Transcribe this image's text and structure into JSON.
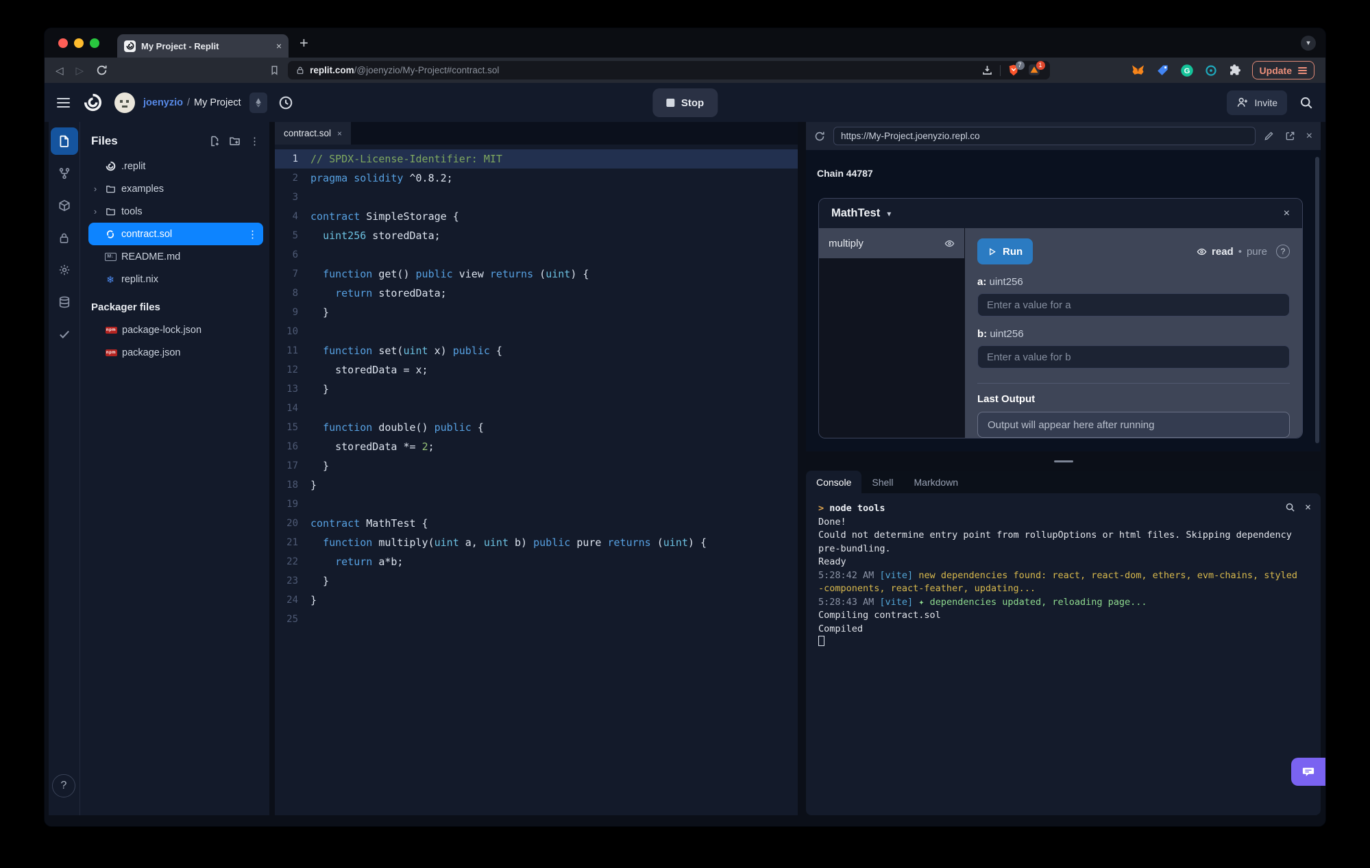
{
  "browser": {
    "tab_title": "My Project - Replit",
    "new_tab": "+",
    "tab_close": "×",
    "tab_search_caret": "▾",
    "back": "◁",
    "forward": "▷",
    "url_host": "replit.com",
    "url_path": "/@joenyzio/My-Project#contract.sol",
    "shield_badge": "7",
    "adshield_badge": "1",
    "update_label": "Update"
  },
  "header": {
    "username": "joenyzio",
    "separator": "/",
    "project": "My Project",
    "stop_label": "Stop",
    "invite_label": "Invite"
  },
  "files": {
    "title": "Files",
    "kebab": "⋮",
    "chevron": "›",
    "items": [
      {
        "label": ".replit",
        "icon": "replit-swirl",
        "chevron": false,
        "selected": false
      },
      {
        "label": "examples",
        "icon": "folder",
        "chevron": true,
        "selected": false
      },
      {
        "label": "tools",
        "icon": "folder",
        "chevron": true,
        "selected": false
      },
      {
        "label": "contract.sol",
        "icon": "solidity",
        "chevron": false,
        "selected": true
      },
      {
        "label": "README.md",
        "icon": "markdown",
        "chevron": false,
        "selected": false
      },
      {
        "label": "replit.nix",
        "icon": "nix",
        "chevron": false,
        "selected": false
      }
    ],
    "packager_heading": "Packager files",
    "packager_items": [
      {
        "label": "package-lock.json",
        "icon": "npm"
      },
      {
        "label": "package.json",
        "icon": "npm"
      }
    ],
    "help": "?"
  },
  "editor": {
    "tab": "contract.sol",
    "tab_close": "×",
    "active_line": 1,
    "lines": [
      {
        "t": [
          [
            "cm",
            "// SPDX-License-Identifier: MIT"
          ]
        ]
      },
      {
        "t": [
          [
            "kw",
            "pragma"
          ],
          [
            "pl",
            " "
          ],
          [
            "kw",
            "solidity"
          ],
          [
            "pl",
            " ^0.8.2;"
          ]
        ]
      },
      {
        "t": []
      },
      {
        "t": [
          [
            "kw",
            "contract"
          ],
          [
            "pl",
            " SimpleStorage {"
          ]
        ]
      },
      {
        "t": [
          [
            "pl",
            "  "
          ],
          [
            "ty",
            "uint256"
          ],
          [
            "pl",
            " storedData;"
          ]
        ]
      },
      {
        "t": []
      },
      {
        "t": [
          [
            "pl",
            "  "
          ],
          [
            "kw",
            "function"
          ],
          [
            "pl",
            " get() "
          ],
          [
            "kw",
            "public"
          ],
          [
            "pl",
            " view "
          ],
          [
            "kw",
            "returns"
          ],
          [
            "pl",
            " ("
          ],
          [
            "ty",
            "uint"
          ],
          [
            "pl",
            ") {"
          ]
        ]
      },
      {
        "t": [
          [
            "pl",
            "    "
          ],
          [
            "kw",
            "return"
          ],
          [
            "pl",
            " storedData;"
          ]
        ]
      },
      {
        "t": [
          [
            "pl",
            "  }"
          ]
        ]
      },
      {
        "t": []
      },
      {
        "t": [
          [
            "pl",
            "  "
          ],
          [
            "kw",
            "function"
          ],
          [
            "pl",
            " set("
          ],
          [
            "ty",
            "uint"
          ],
          [
            "pl",
            " x) "
          ],
          [
            "kw",
            "public"
          ],
          [
            "pl",
            " {"
          ]
        ]
      },
      {
        "t": [
          [
            "pl",
            "    storedData = x;"
          ]
        ]
      },
      {
        "t": [
          [
            "pl",
            "  }"
          ]
        ]
      },
      {
        "t": []
      },
      {
        "t": [
          [
            "pl",
            "  "
          ],
          [
            "kw",
            "function"
          ],
          [
            "pl",
            " double() "
          ],
          [
            "kw",
            "public"
          ],
          [
            "pl",
            " {"
          ]
        ]
      },
      {
        "t": [
          [
            "pl",
            "    storedData *= "
          ],
          [
            "nu",
            "2"
          ],
          [
            "pl",
            ";"
          ]
        ]
      },
      {
        "t": [
          [
            "pl",
            "  }"
          ]
        ]
      },
      {
        "t": [
          [
            "pl",
            "}"
          ]
        ]
      },
      {
        "t": []
      },
      {
        "t": [
          [
            "kw",
            "contract"
          ],
          [
            "pl",
            " MathTest {"
          ]
        ]
      },
      {
        "t": [
          [
            "pl",
            "  "
          ],
          [
            "kw",
            "function"
          ],
          [
            "pl",
            " multiply("
          ],
          [
            "ty",
            "uint"
          ],
          [
            "pl",
            " a, "
          ],
          [
            "ty",
            "uint"
          ],
          [
            "pl",
            " b) "
          ],
          [
            "kw",
            "public"
          ],
          [
            "pl",
            " pure "
          ],
          [
            "kw",
            "returns"
          ],
          [
            "pl",
            " ("
          ],
          [
            "ty",
            "uint"
          ],
          [
            "pl",
            ") {"
          ]
        ]
      },
      {
        "t": [
          [
            "pl",
            "    "
          ],
          [
            "kw",
            "return"
          ],
          [
            "pl",
            " a*b;"
          ]
        ]
      },
      {
        "t": [
          [
            "pl",
            "  }"
          ]
        ]
      },
      {
        "t": [
          [
            "pl",
            "}"
          ]
        ]
      },
      {
        "t": []
      }
    ]
  },
  "webview": {
    "url": "https://My-Project.joenyzio.repl.co",
    "chain": "Chain 44787",
    "contract_name": "MathTest",
    "caret": "▾",
    "close": "×",
    "method": "multiply",
    "run_label": "Run",
    "badge_read": "read",
    "badge_dot": "•",
    "badge_pure": "pure",
    "badge_help": "?",
    "a_label": "a:",
    "a_type": " uint256",
    "a_placeholder": "Enter a value for a",
    "b_label": "b:",
    "b_type": " uint256",
    "b_placeholder": "Enter a value for b",
    "last_output_label": "Last Output",
    "output_placeholder": "Output will appear here after running"
  },
  "console": {
    "tabs": [
      "Console",
      "Shell",
      "Markdown"
    ],
    "close": "×",
    "lines": [
      [
        [
          "prom",
          "> "
        ],
        [
          "bold",
          "node tools"
        ]
      ],
      [
        [
          "p",
          "Done!"
        ]
      ],
      [
        [
          "p",
          "Could not determine entry point from rollupOptions or html files. Skipping dependency"
        ]
      ],
      [
        [
          "p",
          "pre-bundling."
        ]
      ],
      [
        [
          "p",
          "Ready"
        ]
      ],
      [
        [
          "dim",
          "5:28:42 AM "
        ],
        [
          "vite",
          "[vite]"
        ],
        [
          "warn",
          " new dependencies found: react, react-dom, ethers, evm-chains, styled"
        ]
      ],
      [
        [
          "warn",
          "-components, react-feather, updating..."
        ]
      ],
      [
        [
          "dim",
          "5:28:43 AM "
        ],
        [
          "vite",
          "[vite]"
        ],
        [
          "ok",
          " ✦ dependencies updated, reloading page..."
        ]
      ],
      [
        [
          "p",
          "Compiling contract.sol"
        ]
      ],
      [
        [
          "p",
          "Compiled"
        ]
      ],
      [
        [
          "cursor",
          ""
        ]
      ]
    ]
  },
  "colors": {
    "accent_blue": "#0d84ff",
    "run_blue": "#2b7bc2",
    "chat_purple": "#7a63f1",
    "update_salmon": "#ef917c",
    "traffic": [
      "#ff5f57",
      "#febc2e",
      "#29c73f"
    ]
  },
  "icons": {
    "kebab": "⋮",
    "chevron_right": "›",
    "caret_down": "▾",
    "close": "×",
    "check": "✓",
    "gear": "⚙",
    "snowflake": "❄",
    "eth": "◆",
    "play": "▷"
  }
}
